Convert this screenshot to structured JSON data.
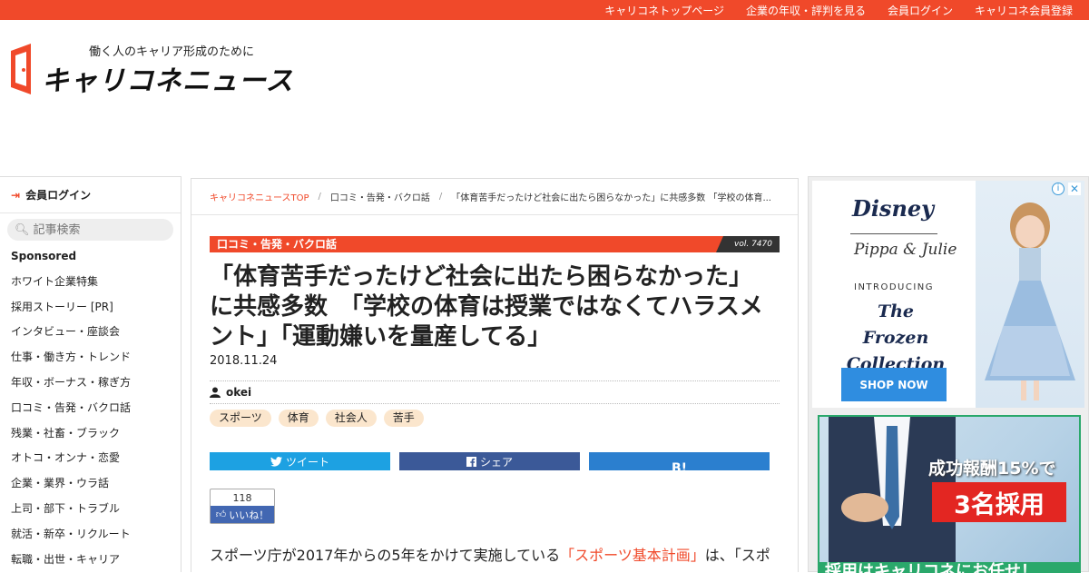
{
  "topnav": {
    "links": [
      "キャリコネトップページ",
      "企業の年収・評判を見る",
      "会員ログイン",
      "キャリコネ会員登録"
    ]
  },
  "logo": {
    "tagline": "働く人のキャリア形成のために",
    "brand": "キャリコネニュース"
  },
  "sidebar": {
    "login_label": "会員ログイン",
    "search_placeholder": "記事検索",
    "menu": [
      "Sponsored",
      "ホワイト企業特集",
      "採用ストーリー [PR]",
      "インタビュー・座談会",
      "仕事・働き方・トレンド",
      "年収・ボーナス・稼ぎ方",
      "口コミ・告発・バクロ話",
      "残業・社畜・ブラック",
      "オトコ・オンナ・恋愛",
      "企業・業界・ウラ話",
      "上司・部下・トラブル",
      "就活・新卒・リクルート",
      "転職・出世・キャリア"
    ]
  },
  "breadcrumb": {
    "top": "キャリコネニュースTOP",
    "category": "口コミ・告発・バクロ話",
    "current": "「体育苦手だったけど社会に出たら困らなかった」に共感多数 「学校の体育..."
  },
  "article": {
    "category": "口コミ・告発・バクロ話",
    "vol": "vol. 7470",
    "title": "「体育苦手だったけど社会に出たら困らなかった」に共感多数　「学校の体育は授業ではなくてハラスメント」「運動嫌いを量産してる」",
    "date": "2018.11.24",
    "author": "okei",
    "tags": [
      "スポーツ",
      "体育",
      "社会人",
      "苦手"
    ],
    "share": {
      "tweet": "ツイート",
      "facebook": "シェア",
      "hatena": "B!"
    },
    "like": {
      "count": "118",
      "label": "いいね！"
    },
    "body_prefix": "スポーツ庁が2017年からの5年をかけて実施している",
    "body_link": "「スポーツ基本計画」",
    "body_suffix": "は、「スポ"
  },
  "ads": {
    "ad1": {
      "brand": "Disney",
      "sub": "Pippa & Julie",
      "intro": "INTRODUCING",
      "collection": "The Frozen Collection",
      "cta": "SHOP NOW"
    },
    "ad2": {
      "line1": "成功報酬15%で",
      "line2": "3名採用",
      "line3": "採用はキャリコネにお任せ！"
    }
  }
}
